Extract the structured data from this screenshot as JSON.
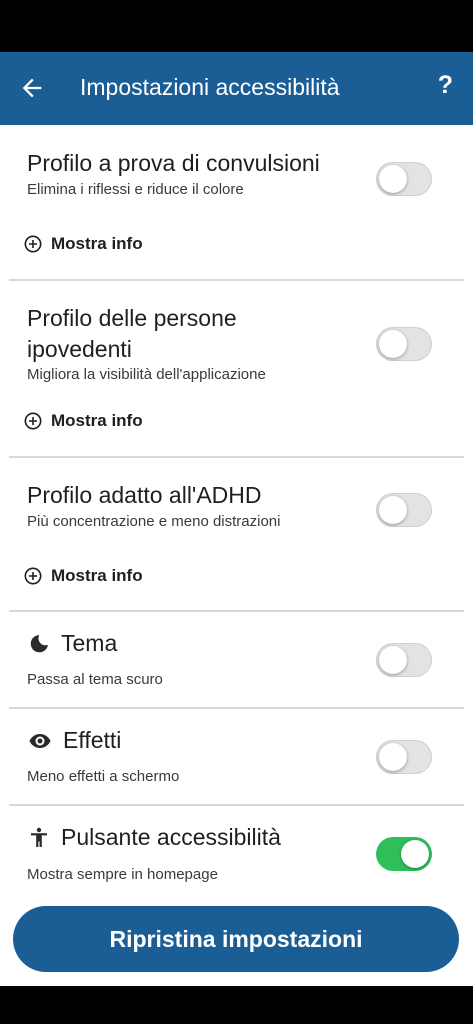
{
  "header": {
    "title": "Impostazioni accessibilità",
    "back_icon": "arrow-left-icon",
    "help_label": "?"
  },
  "profiles": [
    {
      "title": "Profilo a prova di convulsioni",
      "description": "Elimina i riflessi e riduce il colore",
      "info_label": "Mostra info",
      "enabled": false
    },
    {
      "title_line1": "Profilo delle persone",
      "title_line2": "ipovedenti",
      "description": "Migliora la visibilità dell'applicazione",
      "info_label": "Mostra info",
      "enabled": false
    },
    {
      "title": "Profilo adatto all'ADHD",
      "description": "Più concentrazione e meno distrazioni",
      "info_label": "Mostra info",
      "enabled": false
    }
  ],
  "settings": [
    {
      "icon": "moon-icon",
      "title": "Tema",
      "description": "Passa al tema scuro",
      "enabled": false
    },
    {
      "icon": "eye-icon",
      "title": "Effetti",
      "description": "Meno effetti a schermo",
      "enabled": false
    },
    {
      "icon": "accessibility-icon",
      "title": "Pulsante accessibilità",
      "description": "Mostra sempre in homepage",
      "enabled": true
    }
  ],
  "reset_button": {
    "label": "Ripristina impostazioni"
  },
  "colors": {
    "primary": "#1b5e96",
    "toggle_on": "#2fbf5a",
    "toggle_off": "#e3e3e3",
    "divider": "#d9d9d9"
  }
}
